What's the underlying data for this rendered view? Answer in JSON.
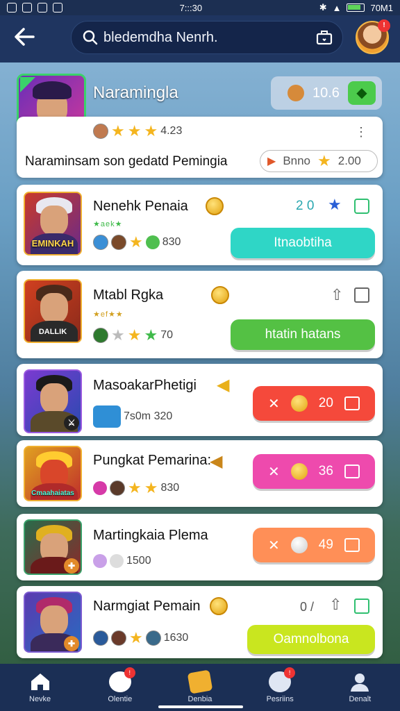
{
  "status_bar": {
    "time": "7:::30",
    "right_time": "70M1"
  },
  "header": {
    "search_text": "bledemdha Nenrh.",
    "avatar_badge": "!"
  },
  "featured": {
    "title": "Naramingla",
    "coins": "10.6",
    "rating_count": "4.23",
    "description": "Naraminsam son gedatd Pemingia",
    "tag_label": "Bnno",
    "tag_value": "2.00",
    "menu": "⋮"
  },
  "games": [
    {
      "title": "Nenehk Penaia",
      "tag": "★aek★",
      "thumb_label": "EMINKAH",
      "stat": "830",
      "top_value": "2 0",
      "button": "Itnaobtiha",
      "button_color": "#2fd6c6"
    },
    {
      "title": "Mtabl Rgka",
      "tag": "★ef★★",
      "thumb_label": "DALLIK",
      "stat": "70",
      "button": "htatin hatans",
      "button_color": "#54c144"
    },
    {
      "title": "MasoakarPhetigi",
      "stat": "7s0m 320",
      "button_value": "20",
      "button_color": "#f5493b"
    },
    {
      "title": "Pungkat Pemarina:",
      "thumb_label": "Cmaahaiatas",
      "stat": "830",
      "button_value": "36",
      "button_color": "#ee4aad"
    },
    {
      "title": "Martingkaia Plema",
      "stat": "1500",
      "button_value": "49",
      "button_color": "#ff8f57"
    },
    {
      "title": "Narmgiat Pemain",
      "stat": "1630",
      "top_value": "0 /",
      "button": "Oamnolbona",
      "button_color": "#c9e61f"
    }
  ],
  "bottom_nav": [
    {
      "label": "Nevke",
      "icon": "home-icon"
    },
    {
      "label": "Olentie",
      "icon": "chat-icon",
      "badge": "!"
    },
    {
      "label": "Denbia",
      "icon": "ticket-icon"
    },
    {
      "label": "Pesriins",
      "icon": "controller-icon",
      "badge": "!"
    },
    {
      "label": "Denalt",
      "icon": "profile-icon"
    }
  ]
}
